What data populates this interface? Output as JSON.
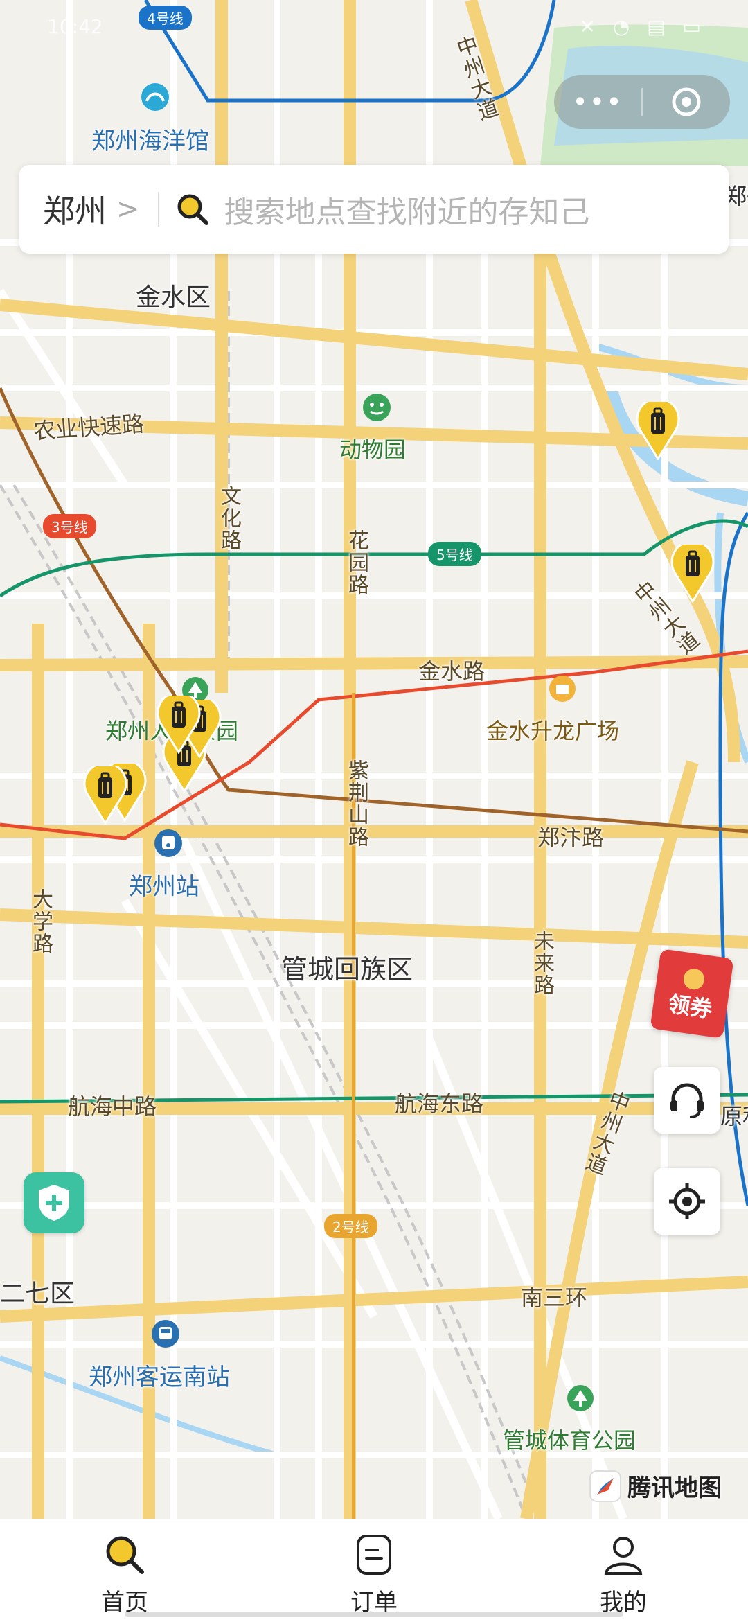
{
  "status_bar": {
    "time": "10:42",
    "icons_text": "✕ ◔ ▤ ▭"
  },
  "mini_program_capsule": {
    "menu_icon": "more-dots-icon",
    "close_icon": "target-close-icon",
    "dots": "•••"
  },
  "search": {
    "city": "郑州",
    "chevron": ">",
    "placeholder": "搜索地点查找附近的存知己"
  },
  "map": {
    "districts": [
      "金水区",
      "管城回族区",
      "二七区"
    ],
    "roads": {
      "nongye": "农业快速路",
      "wenhua": "文化路",
      "huayuan": "花园路",
      "jinshui": "金水路",
      "zijingshan": "紫荆山路",
      "zhengbian": "郑汴路",
      "daxue": "大学路",
      "weilai": "未来路",
      "hanghai_zhong": "航海中路",
      "hanghai_dong": "航海东路",
      "nansanhuan": "南三环",
      "zhongzhou_1": "中州大道",
      "zhongzhou_2": "中州大道",
      "zhongzhou_3": "中州大道"
    },
    "pois": {
      "ocean": "郑州海洋馆",
      "zoo": "动物园",
      "people_park": "郑州人民公园",
      "jinshui_plaza": "金水升龙广场",
      "station": "郑州站",
      "south_bus": "郑州客运南站",
      "sports_park": "管城体育公园",
      "edge_right_1": "郑州",
      "edge_right_2": "原利"
    },
    "metro_lines": {
      "line4": "4号线",
      "line3": "3号线",
      "line5": "5号线",
      "line2": "2号线"
    },
    "colors": {
      "line4": "#1a73c9",
      "line3": "#e84a2e",
      "line5": "#16956a",
      "line2": "#f0a030",
      "major_road": "#f3d27a",
      "water": "#a9d6f3",
      "pin": "#f3c82d"
    },
    "watermark": "腾讯地图"
  },
  "floating": {
    "coupon_label": "领券",
    "support_icon": "headset-icon",
    "locate_icon": "locate-icon",
    "shield_icon": "shield-plus-icon"
  },
  "tabbar": {
    "items": [
      {
        "label": "首页",
        "icon": "search-icon"
      },
      {
        "label": "订单",
        "icon": "order-icon"
      },
      {
        "label": "我的",
        "icon": "person-icon"
      }
    ]
  }
}
